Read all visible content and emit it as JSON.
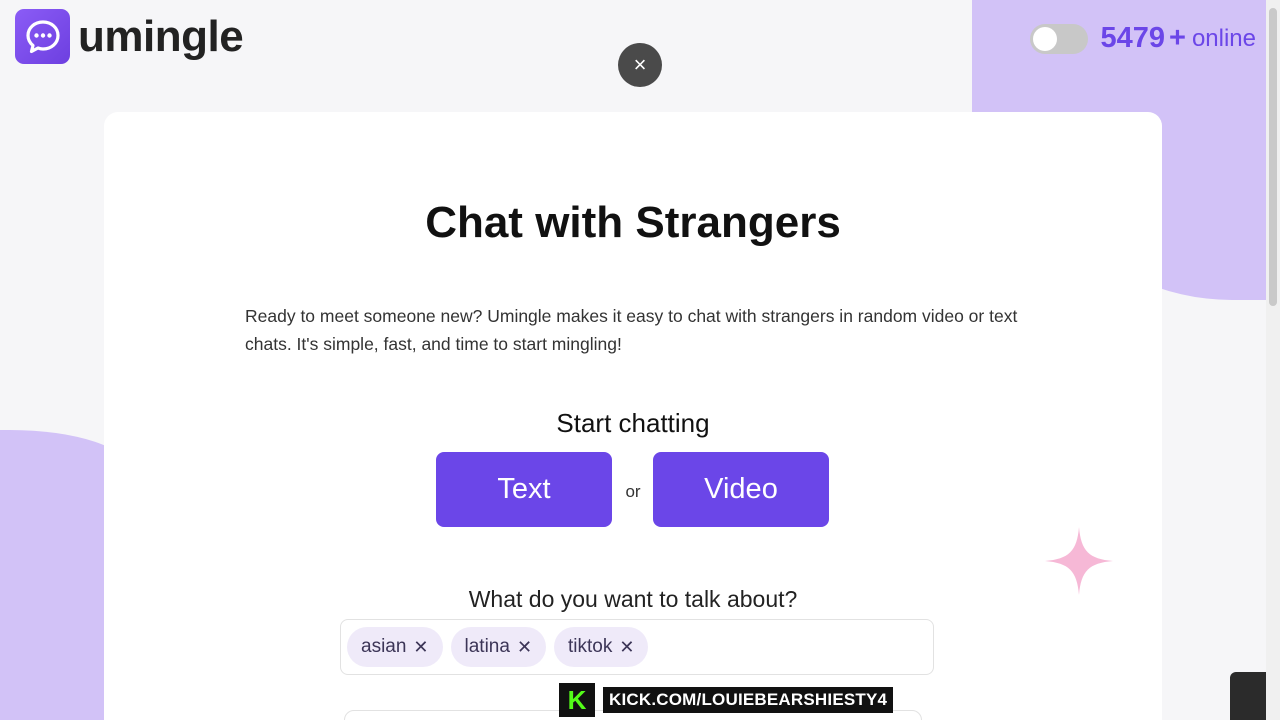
{
  "brand": {
    "name": "umingle",
    "logo_icon": "chat-bubble-icon"
  },
  "header": {
    "close_icon": "×",
    "online_count": "5479",
    "online_plus": "+",
    "online_label": "online"
  },
  "main": {
    "title": "Chat with Strangers",
    "description": "Ready to meet someone new? Umingle makes it easy to chat with strangers in random video or text chats. It's simple, fast, and time to start mingling!",
    "start_label": "Start chatting",
    "text_button": "Text",
    "or_label": "or",
    "video_button": "Video",
    "interests_label": "What do you want to talk about?",
    "tags": [
      {
        "label": "asian",
        "remove": "✕"
      },
      {
        "label": "latina",
        "remove": "✕"
      },
      {
        "label": "tiktok",
        "remove": "✕"
      }
    ]
  },
  "overlay": {
    "kick_logo": "K",
    "kick_text": "KICK.COM/LOUIEBEARSHIESTY4"
  },
  "colors": {
    "accent": "#6b46e8",
    "blob": "#d2c2f7",
    "sparkle": "#f6b8d6"
  }
}
